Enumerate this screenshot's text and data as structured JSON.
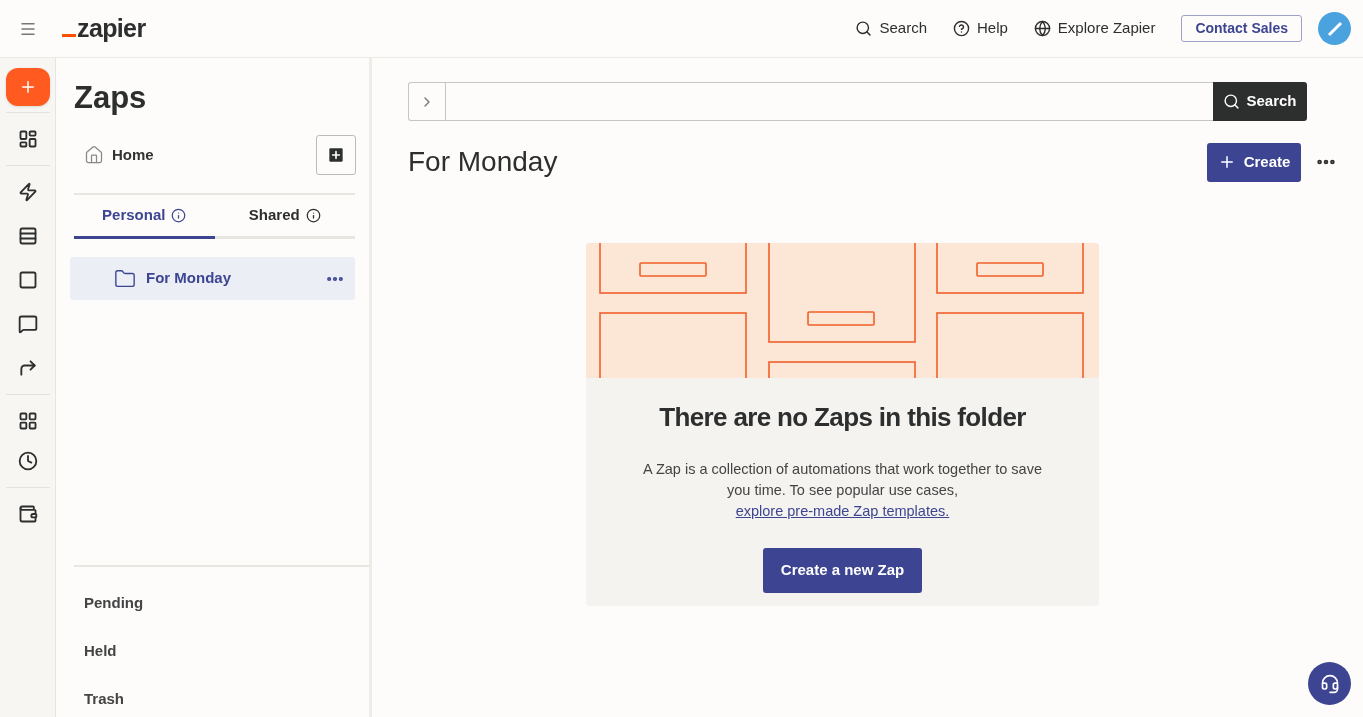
{
  "header": {
    "logo": "zapier",
    "nav": [
      {
        "label": "Search"
      },
      {
        "label": "Help"
      },
      {
        "label": "Explore Zapier"
      }
    ],
    "contact_button": "Contact Sales"
  },
  "sidebar": {
    "title": "Zaps",
    "home": "Home",
    "tabs": [
      {
        "label": "Personal",
        "selected": true
      },
      {
        "label": "Shared",
        "selected": false
      }
    ],
    "folders": [
      {
        "label": "For Monday",
        "selected": true
      }
    ],
    "footer_links": [
      "Pending",
      "Held",
      "Trash"
    ]
  },
  "main": {
    "search_button": "Search",
    "title": "For Monday",
    "create_button": "Create",
    "empty_state": {
      "heading": "There are no Zaps in this folder",
      "description": "A Zap is a collection of automations that work together to save you time. To see popular use cases,",
      "link": "explore pre-made Zap templates.",
      "button": "Create a new Zap"
    }
  }
}
